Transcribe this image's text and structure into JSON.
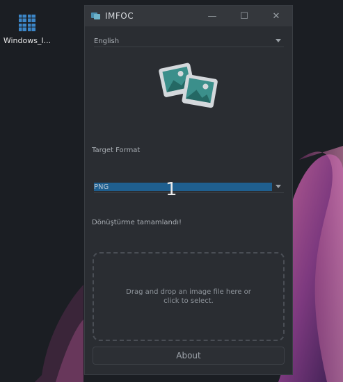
{
  "desktop": {
    "icon_label": "Windows_I..."
  },
  "window": {
    "title": "IMFOC",
    "language_select": {
      "value": "English"
    },
    "target_format_label": "Target Format",
    "format_select": {
      "value": "PNG"
    },
    "overlay_number": "1",
    "status_text": "Dönüştürme tamamlandı!",
    "dropzone_text": "Drag and drop an image file here or click to select.",
    "about_label": "About",
    "controls": {
      "minimize": "—",
      "maximize": "☐",
      "close": "✕"
    }
  },
  "icons": [
    "app-icon",
    "photos-icon",
    "windows-folder-icon",
    "chevron-down-icon"
  ],
  "colors": {
    "accent": "#1f5f8f",
    "window_bg": "#2a2d32",
    "titlebar_bg": "#34373c"
  }
}
